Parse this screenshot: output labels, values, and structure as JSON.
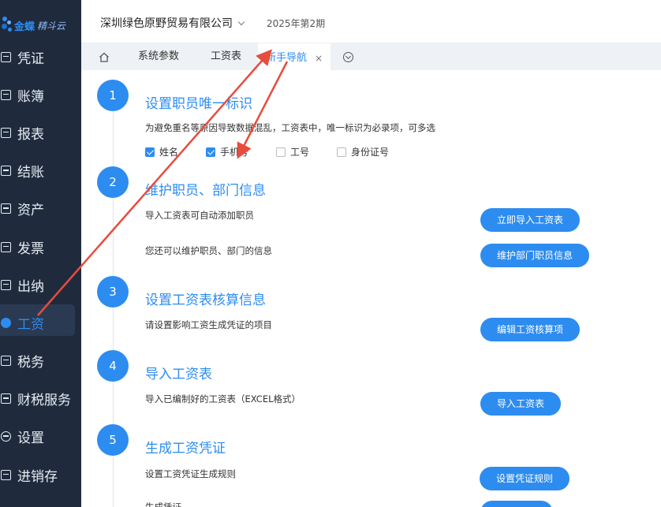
{
  "brand": {
    "name": "金蝶",
    "product": "精斗云"
  },
  "colors": {
    "accent": "#2d8cf0",
    "sidebar": "#1f2b3d",
    "annotation": "#e84c3d"
  },
  "sidebar": {
    "items": [
      {
        "label": "凭证",
        "icon": "voucher-icon"
      },
      {
        "label": "账簿",
        "icon": "ledger-icon"
      },
      {
        "label": "报表",
        "icon": "report-icon"
      },
      {
        "label": "结账",
        "icon": "closing-icon"
      },
      {
        "label": "资产",
        "icon": "asset-icon"
      },
      {
        "label": "发票",
        "icon": "invoice-icon"
      },
      {
        "label": "出纳",
        "icon": "cashier-icon"
      },
      {
        "label": "工资",
        "icon": "yuan-icon",
        "active": true
      },
      {
        "label": "税务",
        "icon": "tax-icon"
      },
      {
        "label": "财税服务",
        "icon": "service-icon"
      },
      {
        "label": "设置",
        "icon": "settings-icon"
      },
      {
        "label": "进销存",
        "icon": "inventory-icon"
      }
    ]
  },
  "header": {
    "company": "深圳绿色原野贸易有限公司",
    "period": "2025年第2期"
  },
  "tabs": [
    {
      "label": "系统参数"
    },
    {
      "label": "工资表"
    },
    {
      "label": "新手导航",
      "active": true,
      "close": "×"
    }
  ],
  "steps": [
    {
      "num": "1",
      "title": "设置职员唯一标识",
      "desc": "为避免重名等原因导致数据混乱，工资表中，唯一标识为必录项，可多选",
      "checkboxes": [
        {
          "label": "姓名",
          "checked": true
        },
        {
          "label": "手机号",
          "checked": true
        },
        {
          "label": "工号",
          "checked": false
        },
        {
          "label": "身份证号",
          "checked": false
        }
      ]
    },
    {
      "num": "2",
      "title": "维护职员、部门信息",
      "rows": [
        {
          "desc": "导入工资表可自动添加职员",
          "button": "立即导入工资表"
        },
        {
          "desc": "您还可以维护职员、部门的信息",
          "button": "维护部门职员信息"
        }
      ]
    },
    {
      "num": "3",
      "title": "设置工资表核算信息",
      "rows": [
        {
          "desc": "请设置影响工资生成凭证的项目",
          "button": "编辑工资核算项"
        }
      ]
    },
    {
      "num": "4",
      "title": "导入工资表",
      "rows": [
        {
          "desc": "导入已编制好的工资表（EXCEL格式）",
          "button": "导入工资表"
        }
      ]
    },
    {
      "num": "5",
      "title": "生成工资凭证",
      "rows": [
        {
          "desc": "设置工资凭证生成规则",
          "button": "设置凭证规则"
        },
        {
          "desc": "生成凭证",
          "button": ""
        }
      ]
    }
  ]
}
